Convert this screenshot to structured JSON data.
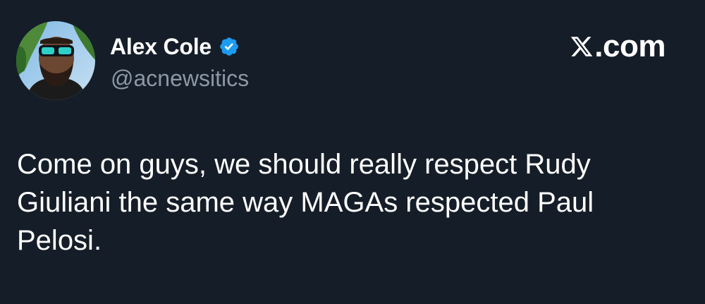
{
  "author": {
    "display_name": "Alex Cole",
    "handle": "@acnewsitics",
    "verified": true,
    "avatar_icon": "profile-photo-icon"
  },
  "brand": {
    "text": ".com",
    "icon": "x-logo-icon"
  },
  "tweet": {
    "lines": [
      "Come on guys, we should really respect Rudy",
      "Giuliani the same way MAGAs respected Paul",
      "Pelosi."
    ]
  },
  "colors": {
    "background": "#151d28",
    "primary_text": "#ffffff",
    "secondary_text": "#8b98a5",
    "verified_badge": "#1d9bf0"
  }
}
